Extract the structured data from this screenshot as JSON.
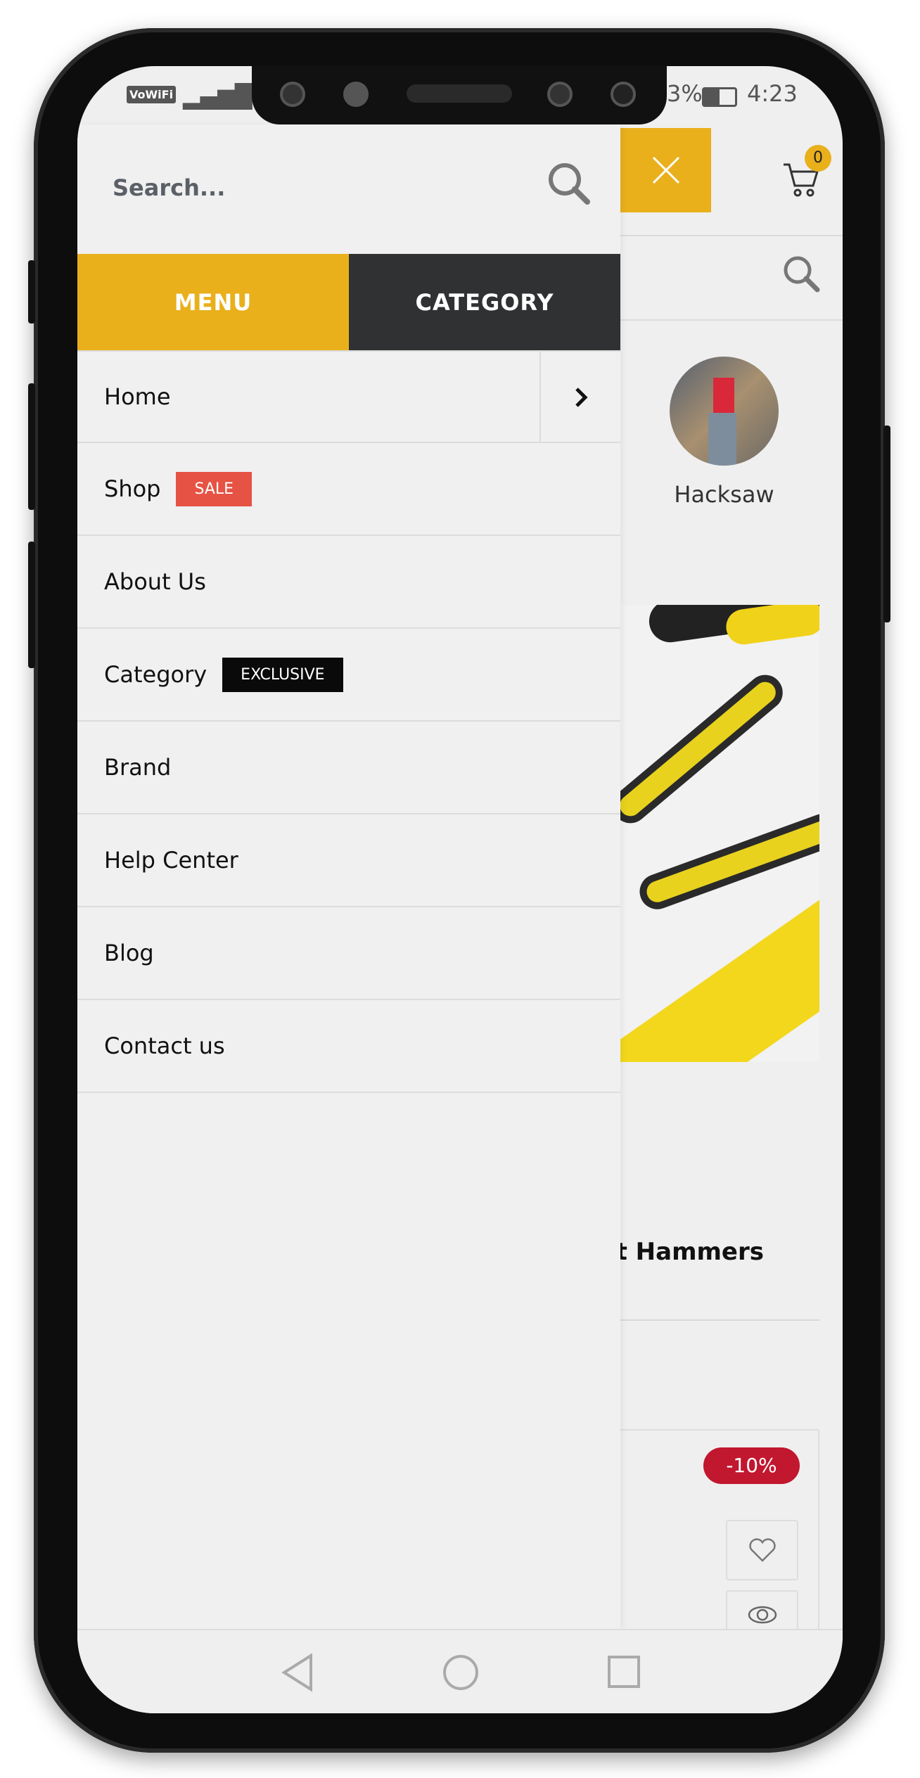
{
  "status_bar": {
    "wifi_label": "VoWiFi",
    "battery": "3%",
    "time": "4:23"
  },
  "drawer": {
    "search_placeholder": "Search...",
    "tabs": [
      {
        "label": "MENU",
        "active": true,
        "color": "#e9b01c"
      },
      {
        "label": "CATEGORY",
        "active": false,
        "color": "#2f3132"
      }
    ],
    "items": [
      {
        "label": "Home",
        "has_submenu": true
      },
      {
        "label": "Shop",
        "badge": "SALE",
        "badge_color": "#e65243"
      },
      {
        "label": "About Us"
      },
      {
        "label": "Category",
        "badge": "EXCLUSIVE",
        "badge_color": "#0a0a0a"
      },
      {
        "label": "Brand"
      },
      {
        "label": "Help Center"
      },
      {
        "label": "Blog"
      },
      {
        "label": "Contact us"
      }
    ]
  },
  "background_page": {
    "cart_count": "0",
    "category_label": "Hacksaw",
    "section_title": "st Hammers",
    "discount_badge": "-10%"
  },
  "colors": {
    "accent": "#e9b01c",
    "discount": "#c1172f"
  }
}
